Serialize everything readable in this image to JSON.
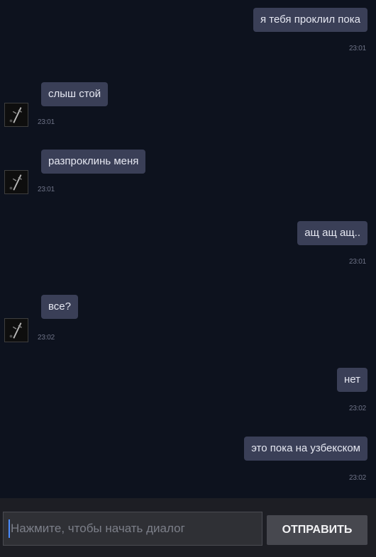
{
  "messages": [
    {
      "side": "out",
      "text": "я тебя проклил пока",
      "time": "23:01"
    },
    {
      "side": "in",
      "text": "слыш стой",
      "time": "23:01"
    },
    {
      "side": "in",
      "text": "разпроклинь меня",
      "time": "23:01"
    },
    {
      "side": "out",
      "text": "ащ ащ ащ..",
      "time": "23:01"
    },
    {
      "side": "in",
      "text": "все?",
      "time": "23:02"
    },
    {
      "side": "out",
      "text": "нет",
      "time": "23:02"
    },
    {
      "side": "out",
      "text": "это пока на узбекском",
      "time": "23:02"
    }
  ],
  "composer": {
    "placeholder": "Нажмите, чтобы начать диалог",
    "send_label": "ОТПРАВИТЬ"
  },
  "icons": {
    "avatar": "avatar-icon"
  },
  "colors": {
    "background": "#0d121e",
    "bubble": "#3a3f57",
    "button": "#47484f"
  }
}
